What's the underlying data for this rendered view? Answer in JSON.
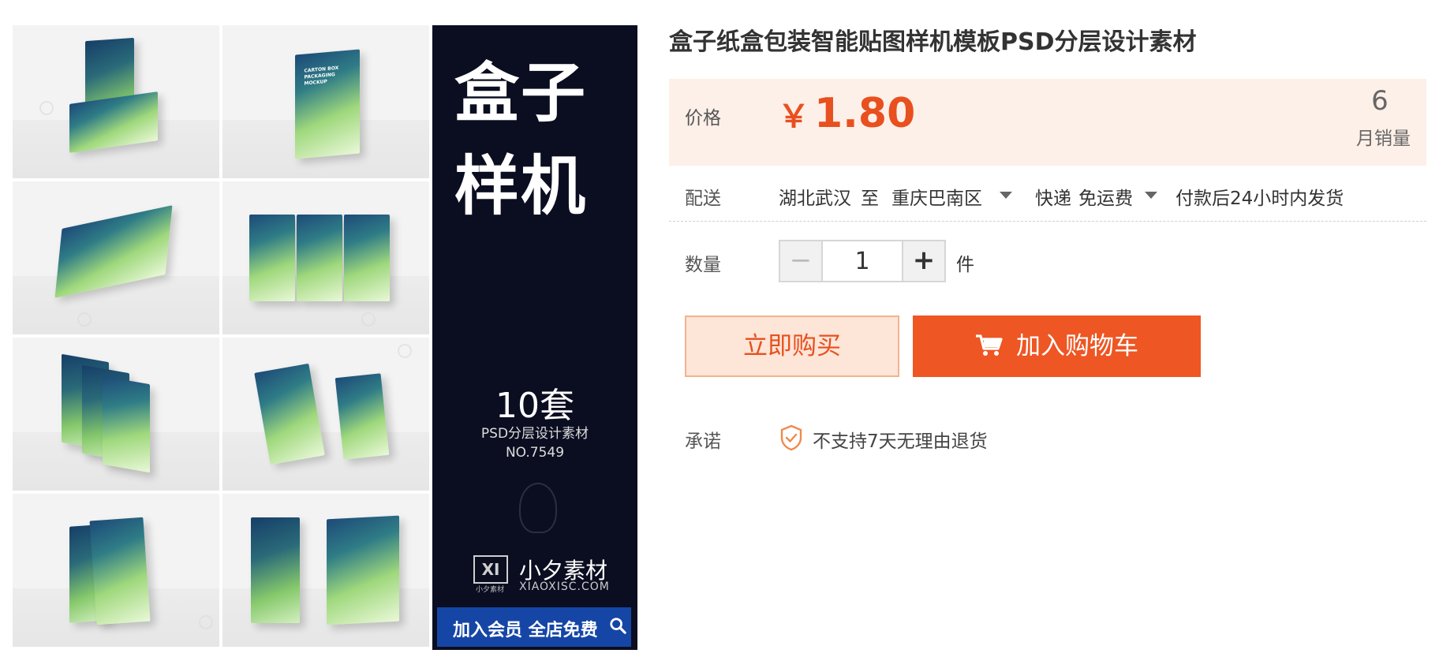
{
  "gallery": {
    "poster_title_line1": "盒子",
    "poster_title_line2": "样机",
    "poster_count": "10套",
    "poster_subtitle": "PSD分层设计素材",
    "poster_number": "NO.7549",
    "logo_mark": "XI",
    "logo_sub": "小夕素材",
    "brand_name": "小夕素材",
    "brand_domain": "XIAOXISC.COM",
    "banner_text": "加入会员 全店免费",
    "box_label": "CARTON BOX PACKAGING MOCKUP",
    "zoom_icon": "magnifier-icon"
  },
  "product": {
    "title": "盒子纸盒包装智能贴图样机模板PSD分层设计素材"
  },
  "price": {
    "label": "价格",
    "currency": "￥",
    "value": "1.80",
    "monthly_sales": "6",
    "monthly_sales_label": "月销量"
  },
  "delivery": {
    "label": "配送",
    "from": "湖北武汉",
    "to_word": "至",
    "destination": "重庆巴南区",
    "method": "快递",
    "fee": "免运费",
    "ship_time": "付款后24小时内发货"
  },
  "quantity": {
    "label": "数量",
    "value": "1",
    "minus": "−",
    "plus": "+",
    "unit": "件"
  },
  "actions": {
    "buy_now": "立即购买",
    "add_to_cart": "加入购物车"
  },
  "promise": {
    "label": "承诺",
    "text": "不支持7天无理由退货"
  },
  "colors": {
    "accent": "#ee5623",
    "price": "#e8501f",
    "price_bg": "#fdf0e8",
    "poster_bg": "#0b0e21"
  }
}
